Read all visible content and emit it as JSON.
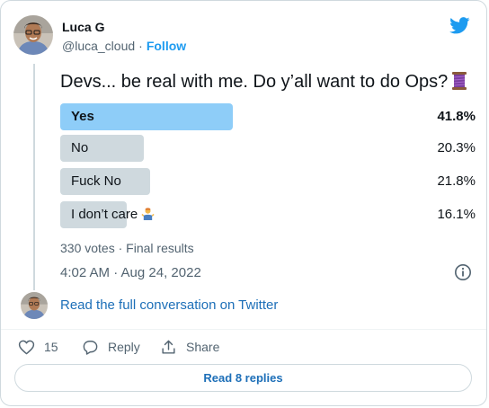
{
  "author": {
    "name": "Luca G",
    "handle": "@luca_cloud",
    "separator": "·",
    "follow_label": "Follow",
    "avatar_icon": "avatar-photo-icon"
  },
  "brand": {
    "icon": "twitter-bird-icon",
    "color": "#1d9bf0"
  },
  "tweet": {
    "text": "Devs... be real with me. Do y’all want to do Ops?",
    "emoji_icon": "thread-spool-icon"
  },
  "poll": {
    "options": [
      {
        "label": "Yes",
        "percent_label": "41.8%",
        "percent": 41.8,
        "winner": true
      },
      {
        "label": "No",
        "percent_label": "20.3%",
        "percent": 20.3,
        "winner": false
      },
      {
        "label": "Fuck No",
        "percent_label": "21.8%",
        "percent": 21.8,
        "winner": false
      },
      {
        "label": "I don’t care",
        "percent_label": "16.1%",
        "percent": 16.1,
        "winner": false,
        "emoji_icon": "person-shrugging-icon"
      }
    ],
    "votes": "330 votes",
    "separator": "·",
    "status": "Final results",
    "bar_colors": {
      "winner": "#8ecdf8",
      "other": "#cfd9de"
    }
  },
  "timestamp": "4:02 AM · Aug 24, 2022",
  "info_icon": "info-icon",
  "read_full_label": "Read the full conversation on Twitter",
  "actions": {
    "like_count": "15",
    "reply_label": "Reply",
    "share_label": "Share"
  },
  "read_replies_label": "Read 8 replies",
  "colors": {
    "link": "#1d6fb8",
    "secondary_text": "#536471",
    "border": "#cfd9de"
  }
}
